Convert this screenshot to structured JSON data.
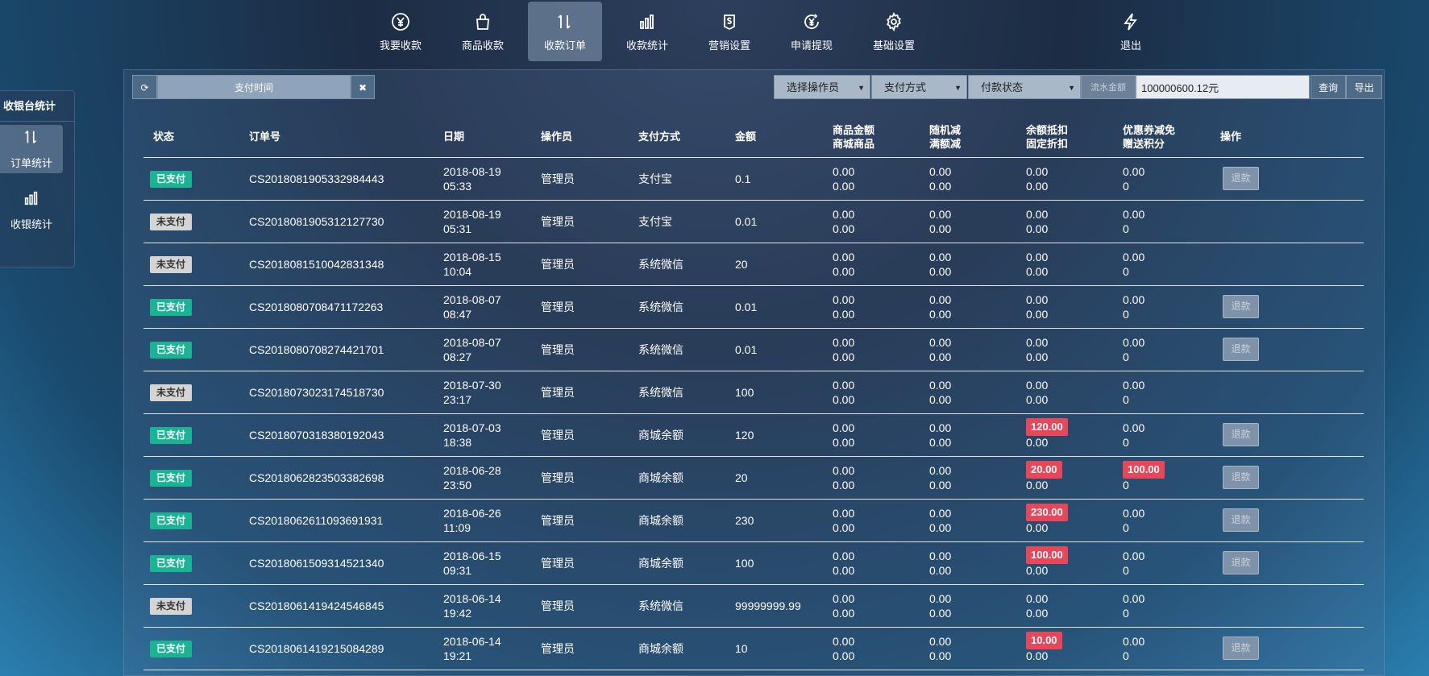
{
  "topnav": {
    "items": [
      {
        "label": "我要收款",
        "icon": "yen-circle-icon"
      },
      {
        "label": "商品收款",
        "icon": "shopping-bag-icon"
      },
      {
        "label": "收款订单",
        "icon": "sort-arrows-icon",
        "active": true
      },
      {
        "label": "收款统计",
        "icon": "bar-chart-icon"
      },
      {
        "label": "营销设置",
        "icon": "dollar-tag-icon"
      },
      {
        "label": "申请提现",
        "icon": "yen-arrow-icon"
      },
      {
        "label": "基础设置",
        "icon": "gear-icon"
      },
      {
        "label": "退出",
        "icon": "lightning-icon"
      }
    ]
  },
  "sidenav": {
    "title": "收银台统计",
    "items": [
      {
        "label": "订单统计",
        "icon": "sort-arrows-icon",
        "active": true
      },
      {
        "label": "收银统计",
        "icon": "bar-chart-icon"
      }
    ]
  },
  "toolbar": {
    "time_label": "支付时间",
    "clear_symbol": "✖",
    "refresh_symbol": "⟳",
    "operator_select": "选择操作员",
    "pay_method_select": "支付方式",
    "pay_status_select": "付款状态",
    "amount_label": "流水金额",
    "amount_value": "100000600.12元",
    "query_label": "查询",
    "export_label": "导出",
    "caret": "▼"
  },
  "table": {
    "headers": {
      "status": "状态",
      "order_no": "订单号",
      "date": "日期",
      "operator": "操作员",
      "pay_method": "支付方式",
      "amount": "金额",
      "goods_1": "商品金额",
      "goods_2": "商城商品",
      "random_1": "随机减",
      "random_2": "满额减",
      "balance_1": "余额抵扣",
      "balance_2": "固定折扣",
      "coupon_1": "优惠券减免",
      "coupon_2": "赠送积分",
      "action": "操作"
    },
    "refund_label": "退款",
    "rows": [
      {
        "status": "已支付",
        "paid": true,
        "order_no": "CS2018081905332984443",
        "date": "2018-08-19",
        "time": "05:33",
        "operator": "管理员",
        "pay_method": "支付宝",
        "amount": "0.1",
        "goods_a": "0.00",
        "goods_b": "0.00",
        "rand_a": "0.00",
        "rand_b": "0.00",
        "bal_a": "0.00",
        "bal_a_red": false,
        "bal_b": "0.00",
        "coup_a": "0.00",
        "coup_a_red": false,
        "coup_b": "0",
        "refund": true
      },
      {
        "status": "未支付",
        "paid": false,
        "order_no": "CS2018081905312127730",
        "date": "2018-08-19",
        "time": "05:31",
        "operator": "管理员",
        "pay_method": "支付宝",
        "amount": "0.01",
        "goods_a": "0.00",
        "goods_b": "0.00",
        "rand_a": "0.00",
        "rand_b": "0.00",
        "bal_a": "0.00",
        "bal_a_red": false,
        "bal_b": "0.00",
        "coup_a": "0.00",
        "coup_a_red": false,
        "coup_b": "0",
        "refund": false
      },
      {
        "status": "未支付",
        "paid": false,
        "order_no": "CS2018081510042831348",
        "date": "2018-08-15",
        "time": "10:04",
        "operator": "管理员",
        "pay_method": "系统微信",
        "amount": "20",
        "goods_a": "0.00",
        "goods_b": "0.00",
        "rand_a": "0.00",
        "rand_b": "0.00",
        "bal_a": "0.00",
        "bal_a_red": false,
        "bal_b": "0.00",
        "coup_a": "0.00",
        "coup_a_red": false,
        "coup_b": "0",
        "refund": false
      },
      {
        "status": "已支付",
        "paid": true,
        "order_no": "CS2018080708471172263",
        "date": "2018-08-07",
        "time": "08:47",
        "operator": "管理员",
        "pay_method": "系统微信",
        "amount": "0.01",
        "goods_a": "0.00",
        "goods_b": "0.00",
        "rand_a": "0.00",
        "rand_b": "0.00",
        "bal_a": "0.00",
        "bal_a_red": false,
        "bal_b": "0.00",
        "coup_a": "0.00",
        "coup_a_red": false,
        "coup_b": "0",
        "refund": true
      },
      {
        "status": "已支付",
        "paid": true,
        "order_no": "CS2018080708274421701",
        "date": "2018-08-07",
        "time": "08:27",
        "operator": "管理员",
        "pay_method": "系统微信",
        "amount": "0.01",
        "goods_a": "0.00",
        "goods_b": "0.00",
        "rand_a": "0.00",
        "rand_b": "0.00",
        "bal_a": "0.00",
        "bal_a_red": false,
        "bal_b": "0.00",
        "coup_a": "0.00",
        "coup_a_red": false,
        "coup_b": "0",
        "refund": true
      },
      {
        "status": "未支付",
        "paid": false,
        "order_no": "CS2018073023174518730",
        "date": "2018-07-30",
        "time": "23:17",
        "operator": "管理员",
        "pay_method": "系统微信",
        "amount": "100",
        "goods_a": "0.00",
        "goods_b": "0.00",
        "rand_a": "0.00",
        "rand_b": "0.00",
        "bal_a": "0.00",
        "bal_a_red": false,
        "bal_b": "0.00",
        "coup_a": "0.00",
        "coup_a_red": false,
        "coup_b": "0",
        "refund": false
      },
      {
        "status": "已支付",
        "paid": true,
        "order_no": "CS2018070318380192043",
        "date": "2018-07-03",
        "time": "18:38",
        "operator": "管理员",
        "pay_method": "商城余额",
        "amount": "120",
        "goods_a": "0.00",
        "goods_b": "0.00",
        "rand_a": "0.00",
        "rand_b": "0.00",
        "bal_a": "120.00",
        "bal_a_red": true,
        "bal_b": "0.00",
        "coup_a": "0.00",
        "coup_a_red": false,
        "coup_b": "0",
        "refund": true
      },
      {
        "status": "已支付",
        "paid": true,
        "order_no": "CS2018062823503382698",
        "date": "2018-06-28",
        "time": "23:50",
        "operator": "管理员",
        "pay_method": "商城余额",
        "amount": "20",
        "goods_a": "0.00",
        "goods_b": "0.00",
        "rand_a": "0.00",
        "rand_b": "0.00",
        "bal_a": "20.00",
        "bal_a_red": true,
        "bal_b": "0.00",
        "coup_a": "100.00",
        "coup_a_red": true,
        "coup_b": "0",
        "refund": true
      },
      {
        "status": "已支付",
        "paid": true,
        "order_no": "CS2018062611093691931",
        "date": "2018-06-26",
        "time": "11:09",
        "operator": "管理员",
        "pay_method": "商城余额",
        "amount": "230",
        "goods_a": "0.00",
        "goods_b": "0.00",
        "rand_a": "0.00",
        "rand_b": "0.00",
        "bal_a": "230.00",
        "bal_a_red": true,
        "bal_b": "0.00",
        "coup_a": "0.00",
        "coup_a_red": false,
        "coup_b": "0",
        "refund": true
      },
      {
        "status": "已支付",
        "paid": true,
        "order_no": "CS2018061509314521340",
        "date": "2018-06-15",
        "time": "09:31",
        "operator": "管理员",
        "pay_method": "商城余额",
        "amount": "100",
        "goods_a": "0.00",
        "goods_b": "0.00",
        "rand_a": "0.00",
        "rand_b": "0.00",
        "bal_a": "100.00",
        "bal_a_red": true,
        "bal_b": "0.00",
        "coup_a": "0.00",
        "coup_a_red": false,
        "coup_b": "0",
        "refund": true
      },
      {
        "status": "未支付",
        "paid": false,
        "order_no": "CS2018061419424546845",
        "date": "2018-06-14",
        "time": "19:42",
        "operator": "管理员",
        "pay_method": "系统微信",
        "amount": "99999999.99",
        "goods_a": "0.00",
        "goods_b": "0.00",
        "rand_a": "0.00",
        "rand_b": "0.00",
        "bal_a": "0.00",
        "bal_a_red": false,
        "bal_b": "0.00",
        "coup_a": "0.00",
        "coup_a_red": false,
        "coup_b": "0",
        "refund": false
      },
      {
        "status": "已支付",
        "paid": true,
        "order_no": "CS2018061419215084289",
        "date": "2018-06-14",
        "time": "19:21",
        "operator": "管理员",
        "pay_method": "商城余额",
        "amount": "10",
        "goods_a": "0.00",
        "goods_b": "0.00",
        "rand_a": "0.00",
        "rand_b": "0.00",
        "bal_a": "10.00",
        "bal_a_red": true,
        "bal_b": "0.00",
        "coup_a": "0.00",
        "coup_a_red": false,
        "coup_b": "0",
        "refund": true
      }
    ]
  },
  "colors": {
    "paid_badge": "#1ab394",
    "unpaid_badge": "#d4d4d4",
    "red_tag": "#e8475a"
  }
}
